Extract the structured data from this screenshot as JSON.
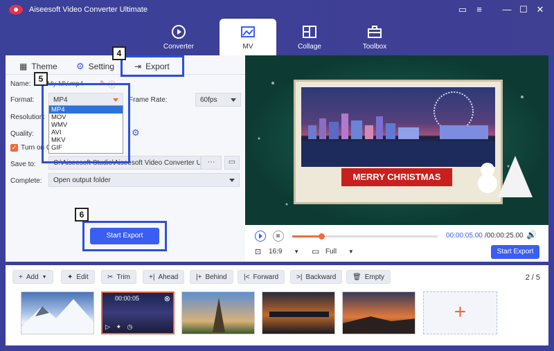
{
  "app": {
    "title": "Aiseesoft Video Converter Ultimate"
  },
  "colors": {
    "accent": "#3a5ef2",
    "header": "#3b4099",
    "orange": "#f06b3c",
    "callout": "#2b4fe0"
  },
  "nav_tabs": [
    {
      "label": "Converter",
      "icon": "converter-icon"
    },
    {
      "label": "MV",
      "icon": "mv-icon"
    },
    {
      "label": "Collage",
      "icon": "collage-icon"
    },
    {
      "label": "Toolbox",
      "icon": "toolbox-icon"
    }
  ],
  "sub_tabs": {
    "theme": "Theme",
    "setting": "Setting",
    "export": "Export"
  },
  "form": {
    "name_label": "Name:",
    "name_value": "My MV.mp4",
    "format_label": "Format:",
    "format_value": "MP4",
    "frame_rate_label": "Frame Rate:",
    "frame_rate_value": "60fps",
    "resolution_label": "Resolution:",
    "quality_label": "Quality:",
    "gpu_label": "Turn on GPU Acceleration",
    "save_to_label": "Save to:",
    "save_to_value": "C:\\Aiseesoft Studio\\Aiseesoft Video Converter Ultimate\\MV Exported",
    "complete_label": "Complete:",
    "complete_value": "Open output folder",
    "more": "···"
  },
  "format_options": [
    "MP4",
    "MOV",
    "WMV",
    "AVI",
    "MKV",
    "GIF"
  ],
  "buttons": {
    "start_export": "Start Export"
  },
  "badges": {
    "export": "4",
    "format": "5",
    "start": "6"
  },
  "preview": {
    "ribbon_text": "MERRY CHRISTMAS",
    "time_current": "00:00:05.00",
    "time_total": "/00:00:25.00",
    "progress": 0.2,
    "aspect": "16:9",
    "view": "Full"
  },
  "toolbar": [
    {
      "label": "Add",
      "icon": "plus-icon"
    },
    {
      "label": "Edit",
      "icon": "edit-icon"
    },
    {
      "label": "Trim",
      "icon": "scissors-icon"
    },
    {
      "label": "Ahead",
      "icon": "ahead-icon"
    },
    {
      "label": "Behind",
      "icon": "behind-icon"
    },
    {
      "label": "Forward",
      "icon": "forward-icon"
    },
    {
      "label": "Backward",
      "icon": "backward-icon"
    },
    {
      "label": "Empty",
      "icon": "trash-icon"
    }
  ],
  "pager": {
    "current": "2",
    "total": "5"
  },
  "clips": [
    {
      "scene": "snowy mountains"
    },
    {
      "scene": "city night skyline",
      "time": "00:00:05"
    },
    {
      "scene": "eiffel tower"
    },
    {
      "scene": "city sunset"
    },
    {
      "scene": "sunset coast"
    }
  ]
}
